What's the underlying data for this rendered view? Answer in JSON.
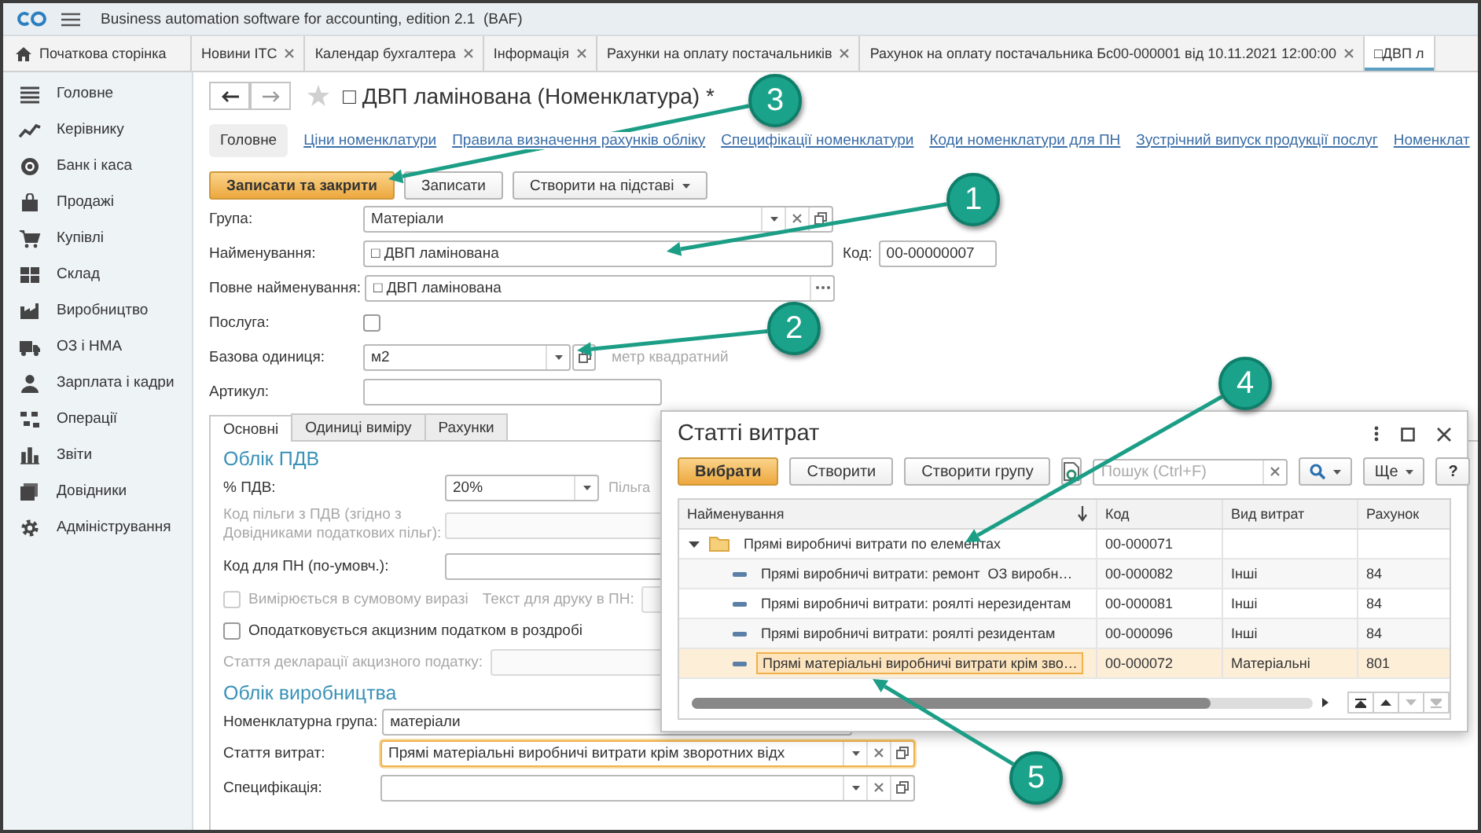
{
  "window": {
    "title": "Business automation software for accounting, edition 2.1  (BAF)"
  },
  "open_tabs": [
    {
      "label": "Початкова сторінка",
      "kind": "home",
      "closable": false,
      "selected": false
    },
    {
      "label": "Новини ІТС",
      "kind": "page",
      "closable": true,
      "selected": false
    },
    {
      "label": "Календар бухгалтера",
      "kind": "page",
      "closable": true,
      "selected": false
    },
    {
      "label": "Інформація",
      "kind": "page",
      "closable": true,
      "selected": false
    },
    {
      "label": "Рахунки на оплату постачальників",
      "kind": "page",
      "closable": true,
      "selected": false
    },
    {
      "label": "Рахунок на оплату постачальника Бс00-000001 від 10.11.2021 12:00:00",
      "kind": "page",
      "closable": true,
      "selected": false
    },
    {
      "label": "□ДВП л",
      "kind": "page",
      "closable": false,
      "selected": true
    }
  ],
  "sidebar": {
    "items": [
      {
        "label": "Головне",
        "selected": false
      },
      {
        "label": "Керівнику",
        "selected": false
      },
      {
        "label": "Банк і каса",
        "selected": false
      },
      {
        "label": "Продажі",
        "selected": false
      },
      {
        "label": "Купівлі",
        "selected": false
      },
      {
        "label": "Склад",
        "selected": false
      },
      {
        "label": "Виробництво",
        "selected": false
      },
      {
        "label": "ОЗ і НМА",
        "selected": false
      },
      {
        "label": "Зарплата і кадри",
        "selected": false
      },
      {
        "label": "Операції",
        "selected": false
      },
      {
        "label": "Звіти",
        "selected": false
      },
      {
        "label": "Довідники",
        "selected": false
      },
      {
        "label": "Адміністрування",
        "selected": false
      }
    ]
  },
  "form": {
    "title": "□ ДВП ламінована (Номенклатура) *",
    "favorite": false,
    "sections": [
      {
        "label": "Головне",
        "selected": true
      },
      {
        "label": "Ціни номенклатури",
        "selected": false
      },
      {
        "label": "Правила визначення рахунків обліку",
        "selected": false
      },
      {
        "label": "Специфікації номенклатури",
        "selected": false
      },
      {
        "label": "Коди номенклатури для ПН",
        "selected": false
      },
      {
        "label": "Зустрічний випуск продукції послуг",
        "selected": false
      },
      {
        "label": "Номенклат",
        "selected": false
      }
    ],
    "actions": [
      {
        "label": "Записати та закрити",
        "kind": "primary"
      },
      {
        "label": "Записати",
        "kind": "plain"
      },
      {
        "label": "Створити на підставі",
        "kind": "menu"
      }
    ],
    "fields": [
      {
        "label": "Група:",
        "kind": "select",
        "value": "Матеріали"
      },
      {
        "label": "Найменування:",
        "kind": "text",
        "value": "□ ДВП ламінована",
        "code_label": "Код:",
        "code_value": "00-00000007"
      },
      {
        "label": "Повне найменування:",
        "kind": "text_more",
        "value": "□ ДВП ламінована"
      },
      {
        "label": "Послуга:",
        "kind": "checkbox",
        "checked": false
      },
      {
        "label": "Базова одиниця:",
        "kind": "unit",
        "value": "м2",
        "note": "метр квадратний"
      },
      {
        "label": "Артикул:",
        "kind": "text"
      }
    ],
    "detail_tabs": [
      {
        "label": "Основні",
        "selected": true
      },
      {
        "label": "Одиниці виміру",
        "selected": false
      },
      {
        "label": "Рахунки",
        "selected": false
      }
    ],
    "vat": {
      "heading": "Облік ПДВ",
      "rate_label": "% ПДВ:",
      "rate_value": "20%",
      "benefit": {
        "label": "Пільга",
        "disabled": true
      },
      "benefit_code": {
        "label": "Код пільги з ПДВ (згідно з Довідниками податкових пільг):",
        "disabled": true
      },
      "tax_invoice_code": {
        "label": "Код для ПН (по-умовч.):",
        "disabled": false
      },
      "sum_measured": {
        "label": "Вимірюється в сумовому виразі",
        "checked": false,
        "disabled": true
      },
      "print_text": {
        "label": "Текст для друку в ПН:",
        "disabled": true
      },
      "excise_retail": {
        "label": "Оподатковується акцизним податком в роздробі",
        "checked": false,
        "disabled": false
      },
      "excise_article": {
        "label": "Стаття декларації акцизного податку:",
        "disabled": true
      }
    },
    "production": {
      "heading": "Облік виробництва",
      "group_label": "Номенклатурна група:",
      "group_value": "матеріали",
      "cost_item_label": "Стаття витрат:",
      "cost_item_value": "Прямі матеріальні виробничі витрати крім зворотних відх",
      "cost_item_focused": true,
      "specification_label": "Специфікація:"
    }
  },
  "dialog": {
    "title": "Статті витрат",
    "buttons": [
      {
        "label": "Вибрати",
        "kind": "primary"
      },
      {
        "label": "Створити",
        "kind": "plain"
      },
      {
        "label": "Створити групу",
        "kind": "plain"
      }
    ],
    "search": {
      "placeholder": "Пошук (Ctrl+F)"
    },
    "more_label": "Ще",
    "help_label": "?",
    "columns": [
      "Найменування",
      "Код",
      "Вид витрат",
      "Рахунок"
    ],
    "rows": [
      {
        "name": "Прямі виробничі витрати по елементах",
        "code": "00-000071",
        "kind": "group",
        "expanded": true,
        "selected": false,
        "children": [
          {
            "name": "Прямі виробничі витрати: ремонт  ОЗ виробн…",
            "code": "00-000082",
            "cost_type": "Інші",
            "account": "84",
            "kind": "item",
            "selected": false
          },
          {
            "name": "Прямі виробничі витрати: роялті нерезидентам",
            "code": "00-000081",
            "cost_type": "Інші",
            "account": "84",
            "kind": "item",
            "selected": false
          },
          {
            "name": "Прямі виробничі витрати: роялті резидентам",
            "code": "00-000096",
            "cost_type": "Інші",
            "account": "84",
            "kind": "item",
            "selected": false
          },
          {
            "name": "Прямі матеріальні виробничі витрати крім зво…",
            "code": "00-000072",
            "cost_type": "Матеріальні",
            "account": "801",
            "kind": "item",
            "selected": true
          }
        ]
      }
    ]
  },
  "callouts": [
    {
      "number": "1"
    },
    {
      "number": "2"
    },
    {
      "number": "3"
    },
    {
      "number": "4"
    },
    {
      "number": "5"
    }
  ]
}
